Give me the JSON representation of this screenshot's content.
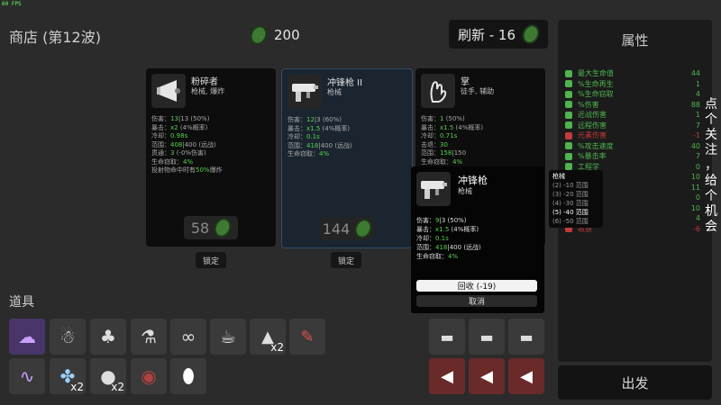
{
  "fps": "60 FPS",
  "shop": {
    "title": "商店 (第12波)",
    "materials": "200",
    "reroll_label": "刷新 - 16"
  },
  "cards": [
    {
      "name": "粉碎者",
      "tags": "枪械, 爆炸",
      "stats": [
        {
          "pre": "伤害：",
          "a": "13",
          "b": "|13 (50%",
          "post": ")"
        },
        {
          "pre": "暴击：",
          "a": "x2",
          "b": " (4%概率)",
          "post": ""
        },
        {
          "pre": "冷却：",
          "a": "0.98s",
          "b": "",
          "post": ""
        },
        {
          "pre": "范围：",
          "a": "408",
          "b": "|400 (远战)",
          "post": ""
        },
        {
          "pre": "贯通：",
          "a": "3",
          "b": " (-0%伤害)",
          "post": ""
        },
        {
          "pre": "生命窃取：",
          "a": "4%",
          "b": "",
          "post": ""
        },
        {
          "pre": "投射物命中时有",
          "a": "50%",
          "b": "爆炸",
          "post": ""
        }
      ],
      "price": "58",
      "lock": "锁定"
    },
    {
      "name": "冲锋枪 II",
      "tags": "枪械",
      "stats": [
        {
          "pre": "伤害：",
          "a": "12",
          "b": "|3 (60%",
          "post": ")"
        },
        {
          "pre": "暴击：",
          "a": "x1.5",
          "b": " (4%概率)",
          "post": ""
        },
        {
          "pre": "冷却：",
          "a": "0.1s",
          "b": "",
          "post": ""
        },
        {
          "pre": "范围：",
          "a": "418",
          "b": "|400 (远战)",
          "post": ""
        },
        {
          "pre": "生命窃取：",
          "a": "4%",
          "b": "",
          "post": ""
        }
      ],
      "price": "144",
      "lock": "锁定"
    },
    {
      "name": "掌",
      "tags": "徒手, 辅助",
      "stats": [
        {
          "pre": "伤害：",
          "a": "1",
          "b": " (50%",
          "post": ")"
        },
        {
          "pre": "暴击：",
          "a": "x1.5",
          "b": " (4%概率)",
          "post": ""
        },
        {
          "pre": "冷却：",
          "a": "0.71s",
          "b": "",
          "post": ""
        },
        {
          "pre": "击退：",
          "a": "30",
          "b": "",
          "post": ""
        },
        {
          "pre": "范围：",
          "a": "158",
          "b": "|150",
          "post": ""
        },
        {
          "pre": "生命窃取：",
          "a": "4%",
          "b": "",
          "post": ""
        }
      ]
    }
  ],
  "props": {
    "label": "道具",
    "x2": "x2"
  },
  "attributes": {
    "title": "属性",
    "rows": [
      {
        "label": "最大生命值",
        "value": "44",
        "color": "#4fb34f"
      },
      {
        "label": "%生命再生",
        "value": "1",
        "color": "#4fb34f"
      },
      {
        "label": "%生命窃取",
        "value": "4",
        "color": "#4fb34f"
      },
      {
        "label": "%伤害",
        "value": "88",
        "color": "#4fb34f"
      },
      {
        "label": "近战伤害",
        "value": "1",
        "color": "#4fb34f"
      },
      {
        "label": "远程伤害",
        "value": "7",
        "color": "#4fb34f"
      },
      {
        "label": "元素伤害",
        "value": "-1",
        "color": "#c23a3a"
      },
      {
        "label": "%攻击速度",
        "value": "40",
        "color": "#4fb34f"
      },
      {
        "label": "%暴击率",
        "value": "7",
        "color": "#4fb34f"
      },
      {
        "label": "工程学",
        "value": "0",
        "color": "#4fb34f"
      },
      {
        "label": "%范围",
        "value": "10",
        "color": "#4fb34f"
      },
      {
        "label": "护甲",
        "value": "11",
        "color": "#4fb34f"
      },
      {
        "label": "%闪避",
        "value": "0",
        "color": "#4fb34f"
      },
      {
        "label": "%速度",
        "value": "10",
        "color": "#4fb34f"
      },
      {
        "label": "幸运",
        "value": "4",
        "color": "#4fb34f"
      },
      {
        "label": "收获",
        "value": "-6",
        "color": "#c23a3a"
      }
    ]
  },
  "go_label": "出发",
  "popup": {
    "name": "冲锋枪",
    "tags": "枪械",
    "stats": [
      {
        "pre": "伤害：",
        "a": "9",
        "b": "|3 (50%",
        "post": ")"
      },
      {
        "pre": "暴击：",
        "a": "x1.5",
        "b": " (4%概率)",
        "post": ""
      },
      {
        "pre": "冷却：",
        "a": "0.1s",
        "b": "",
        "post": ""
      },
      {
        "pre": "范围：",
        "a": "418",
        "b": "|400 (远战)",
        "post": ""
      },
      {
        "pre": "生命窃取：",
        "a": "4%",
        "b": "",
        "post": ""
      }
    ],
    "recycle": "回收 (-19)",
    "cancel": "取消"
  },
  "synergy": {
    "title": "枪械",
    "rows": [
      {
        "text": "(2) -10 范围",
        "active": false
      },
      {
        "text": "(3) -20 范围",
        "active": false
      },
      {
        "text": "(4) -30 范围",
        "active": false
      },
      {
        "text": "(5) -40 范围",
        "active": true
      },
      {
        "text": "(6) -50 范围",
        "active": false
      }
    ]
  },
  "vertical_text": [
    "点",
    "个",
    "关",
    "注",
    "，",
    "给",
    "个",
    "机",
    "会"
  ]
}
